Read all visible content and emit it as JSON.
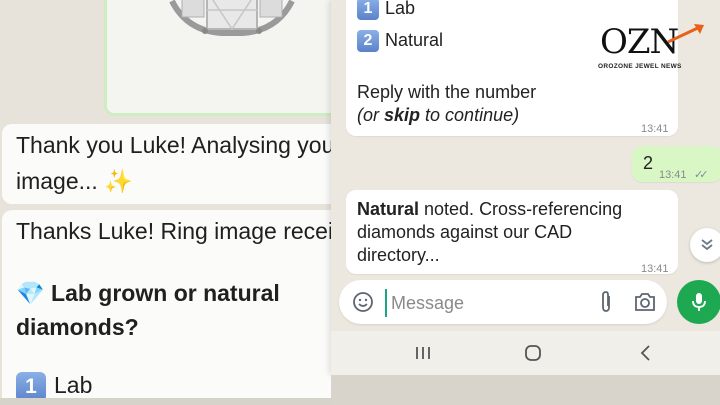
{
  "left_chat": {
    "msg1_line1": "Thank you Luke! Analysing you",
    "msg1_line2": "image...",
    "msg1_emoji": "✨",
    "msg2_line1": "Thanks Luke! Ring image recei",
    "msg2_gem": "💎",
    "msg2_q1": "Lab grown or natural",
    "msg2_q2": "diamonds?",
    "opt1_num": "1",
    "opt1_label": "Lab"
  },
  "phone": {
    "options": [
      {
        "num": "1",
        "label": "Lab"
      },
      {
        "num": "2",
        "label": "Natural"
      }
    ],
    "reply_line1": "Reply with the number",
    "reply_line2_pre": "(or ",
    "reply_line2_bold": "skip",
    "reply_line2_post": " to continue)",
    "time1": "13:41",
    "out_text": "2",
    "out_time": "13:41",
    "out_ticks": "✓✓",
    "in_bold": "Natural",
    "in_line1_rest": " noted. Cross-referencing",
    "in_line2": "diamonds against our CAD",
    "in_line3": "directory...",
    "in_time": "13:41",
    "input_placeholder": "Message"
  },
  "logo": {
    "word": "OZN",
    "tagline": "OROZONE JEWEL NEWS",
    "accent": "#e8611a"
  },
  "colors": {
    "outgoing_bubble": "#d8f7c5",
    "mic_button": "#1ea852",
    "cursor": "#1aa685"
  }
}
